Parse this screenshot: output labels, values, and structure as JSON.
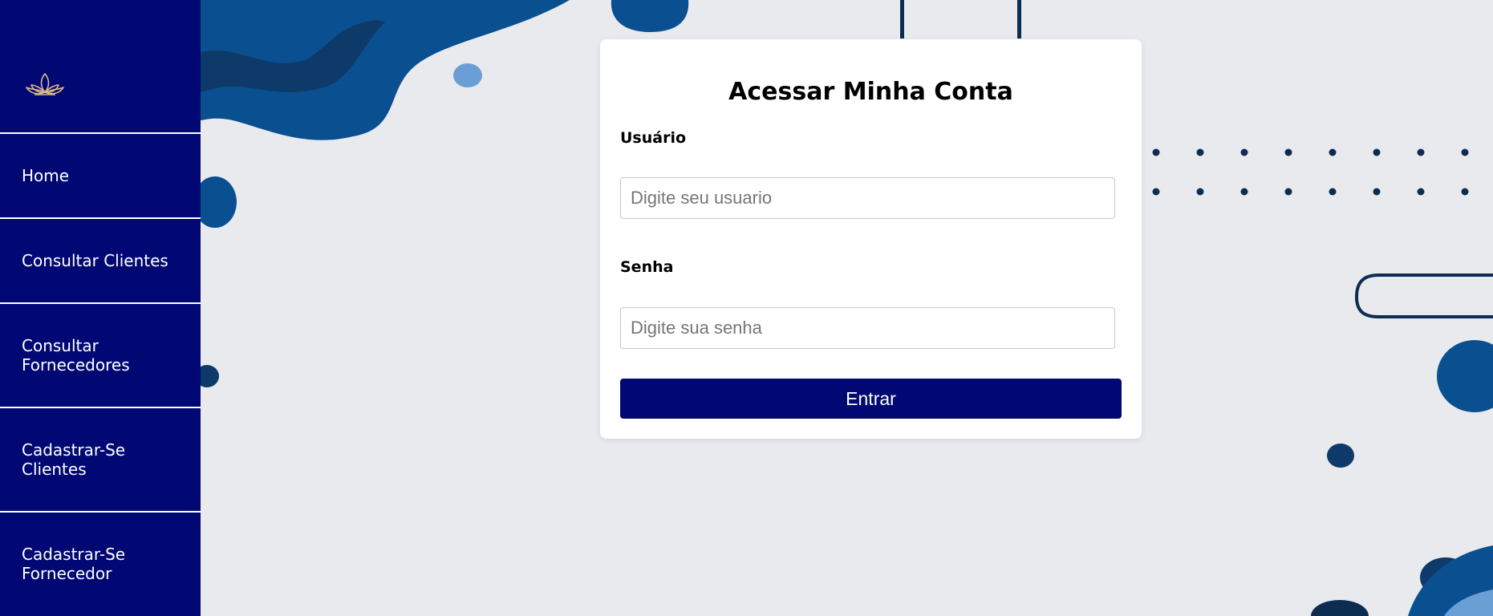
{
  "sidebar": {
    "logo_icon": "lotus-icon",
    "logo_color": "#d9b98a",
    "items": [
      {
        "label_lines": [
          "Home"
        ]
      },
      {
        "label_lines": [
          "Consultar Clientes"
        ]
      },
      {
        "label_lines": [
          "Consultar",
          "Fornecedores"
        ]
      },
      {
        "label_lines": [
          "Cadastrar-Se",
          "Clientes"
        ]
      },
      {
        "label_lines": [
          "Cadastrar-Se",
          "Fornecedor"
        ]
      }
    ]
  },
  "login": {
    "title": "Acessar Minha Conta",
    "username": {
      "label": "Usuário",
      "placeholder": "Digite seu usuario",
      "value": ""
    },
    "password": {
      "label": "Senha",
      "placeholder": "Digite sua senha",
      "value": ""
    },
    "submit_label": "Entrar"
  },
  "colors": {
    "brand_navy": "#020873",
    "background": "#e8eaee",
    "decor_blue": "#0a4f8f",
    "decor_dark": "#0d2d50",
    "decor_light": "#6a9fd6"
  }
}
